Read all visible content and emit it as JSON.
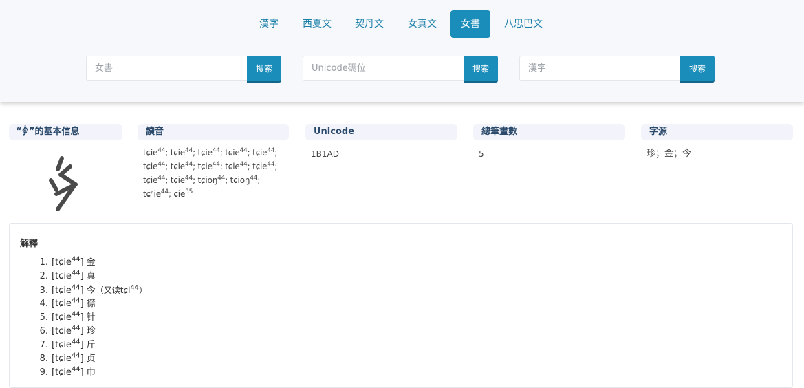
{
  "nav": {
    "tabs": [
      {
        "label": "漢字",
        "active": false
      },
      {
        "label": "西夏文",
        "active": false
      },
      {
        "label": "契丹文",
        "active": false
      },
      {
        "label": "女真文",
        "active": false
      },
      {
        "label": "女書",
        "active": true
      },
      {
        "label": "八思巴文",
        "active": false
      }
    ]
  },
  "searches": [
    {
      "placeholder": "女書",
      "button": "搜索"
    },
    {
      "placeholder": "Unicode碼位",
      "button": "搜索"
    },
    {
      "placeholder": "漢字",
      "button": "搜索"
    }
  ],
  "info": {
    "basic_title": "“𛆭”的基本信息",
    "readings_title": "讀音",
    "unicode_title": "Unicode",
    "strokes_title": "總筆畫數",
    "source_title": "字源",
    "readings": [
      {
        "base": "tɕie",
        "tone": "44"
      },
      {
        "base": "tɕie",
        "tone": "44"
      },
      {
        "base": "tɕie",
        "tone": "44"
      },
      {
        "base": "tɕie",
        "tone": "44"
      },
      {
        "base": "tɕie",
        "tone": "44"
      },
      {
        "base": "tɕie",
        "tone": "44"
      },
      {
        "base": "tɕie",
        "tone": "44"
      },
      {
        "base": "tɕie",
        "tone": "44"
      },
      {
        "base": "tɕie",
        "tone": "44"
      },
      {
        "base": "tɕie",
        "tone": "44"
      },
      {
        "base": "tɕie",
        "tone": "44"
      },
      {
        "base": "tɕie",
        "tone": "44"
      },
      {
        "base": "tɕioŋ",
        "tone": "44"
      },
      {
        "base": "tɕioŋ",
        "tone": "44"
      },
      {
        "base": "tɕʰie",
        "tone": "44"
      },
      {
        "base": "ɕie",
        "tone": "35"
      }
    ],
    "unicode": "1B1AD",
    "strokes": "5",
    "source": "珍；金；今"
  },
  "explanation": {
    "title": "解釋",
    "items": [
      {
        "num": "1.",
        "reading": "tɕie",
        "tone": "44",
        "gloss": "金"
      },
      {
        "num": "2.",
        "reading": "tɕie",
        "tone": "44",
        "gloss": "真"
      },
      {
        "num": "3.",
        "reading": "tɕie",
        "tone": "44",
        "gloss": "今",
        "note_prefix": "（又读",
        "note_reading": "tɕi",
        "note_tone": "44",
        "note_suffix": "）"
      },
      {
        "num": "4.",
        "reading": "tɕie",
        "tone": "44",
        "gloss": "襟"
      },
      {
        "num": "5.",
        "reading": "tɕie",
        "tone": "44",
        "gloss": "针"
      },
      {
        "num": "6.",
        "reading": "tɕie",
        "tone": "44",
        "gloss": "珍"
      },
      {
        "num": "7.",
        "reading": "tɕie",
        "tone": "44",
        "gloss": "斤"
      },
      {
        "num": "8.",
        "reading": "tɕie",
        "tone": "44",
        "gloss": "贞"
      },
      {
        "num": "9.",
        "reading": "tɕie",
        "tone": "44",
        "gloss": "巾"
      }
    ]
  },
  "colors": {
    "accent": "#1a8dbb",
    "tab_text": "#1a7fa8",
    "heading": "#2b4a6b",
    "band": "#f7f8fc"
  }
}
